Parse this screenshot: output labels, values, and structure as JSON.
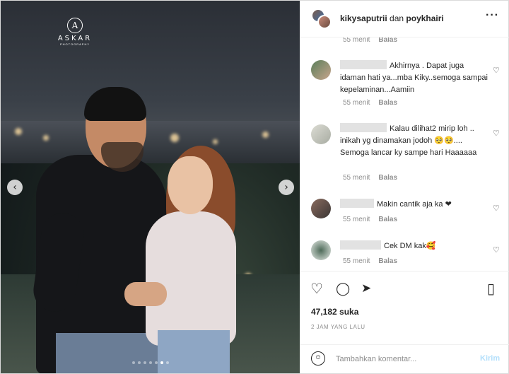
{
  "header": {
    "user1": "kikysaputrii",
    "and": " dan ",
    "user2": "poykhairi",
    "more_icon": "more-horizontal-icon"
  },
  "photo": {
    "watermark_title": "ASKAR",
    "watermark_sub": "PHOTOGRAPHY",
    "watermark_logo": "A",
    "prev_arrow": "‹",
    "next_arrow": "›",
    "carousel_total": 7,
    "carousel_active": 6
  },
  "top_meta": {
    "time": "55 menit",
    "reply": "Balas"
  },
  "comments": [
    {
      "text": "Akhirnya . Dapat juga idaman hati ya...mba Kiky..semoga sampai kepelaminan...Aamiin",
      "time": "55 menit",
      "reply": "Balas",
      "heart": "♡"
    },
    {
      "text": "Kalau dilihat2 mirip loh .. inikah yg dinamakan jodoh 🥺🥺.... Semoga lancar ky sampe hari Haaaaaa",
      "time": "55 menit",
      "reply": "Balas",
      "heart": "♡"
    },
    {
      "text": "Makin cantik aja ka ❤",
      "time": "55 menit",
      "reply": "Balas",
      "heart": "♡"
    },
    {
      "text": "Cek DM kak🥰",
      "time": "55 menit",
      "reply": "Balas",
      "heart": "♡"
    }
  ],
  "actions": {
    "like_icon": "♡",
    "comment_icon": "◯",
    "share_icon": "➤",
    "save_icon": "▯",
    "likes_count": "47,182",
    "likes_suffix": " suka",
    "time_ago": "2 JAM YANG LALU"
  },
  "add_comment": {
    "emoji_icon": "☺",
    "placeholder": "Tambahkan komentar...",
    "send_label": "Kirim"
  },
  "colors": {
    "send_disabled": "#b2dffc",
    "muted": "#8e8e8e",
    "text": "#262626"
  }
}
